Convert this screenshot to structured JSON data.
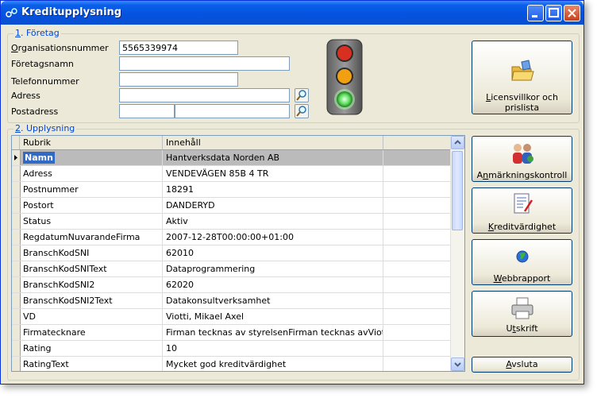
{
  "window": {
    "title": "Kreditupplysning",
    "accent": "#0a5fe8"
  },
  "foretag": {
    "legend_num": "1",
    "legend_text": ". Företag",
    "org_label_u": "O",
    "org_label_rest": "rganisationsnummer",
    "org_value": "5565339974",
    "namn_label": "Företagsnamn",
    "namn_value": "",
    "tel_label": "Telefonnummer",
    "tel_value": "",
    "adress_label": "Adress",
    "adress_value": "",
    "postadress_label": "Postadress",
    "postnr_value": "",
    "postort_value": ""
  },
  "traffic_light": {
    "active": "green",
    "colors": {
      "red": "#d83020",
      "yellow": "#f0a010",
      "green": "#60e060"
    }
  },
  "license_button": {
    "label_u": "L",
    "label_rest": "icensvillkor och",
    "label_line2": "prislista"
  },
  "upplysning": {
    "legend_num": "2",
    "legend_text": ". Upplysning",
    "columns": [
      "Rubrik",
      "Innehåll"
    ],
    "rows": [
      {
        "rubrik": "Namn",
        "innehall": "Hantverksdata Norden AB"
      },
      {
        "rubrik": "Adress",
        "innehall": "VENDEVÄGEN 85B 4 TR"
      },
      {
        "rubrik": "Postnummer",
        "innehall": "18291"
      },
      {
        "rubrik": "Postort",
        "innehall": "DANDERYD"
      },
      {
        "rubrik": "Status",
        "innehall": "Aktiv"
      },
      {
        "rubrik": "RegdatumNuvarandeFirma",
        "innehall": "2007-12-28T00:00:00+01:00"
      },
      {
        "rubrik": "BranschKodSNI",
        "innehall": "62010"
      },
      {
        "rubrik": "BranschKodSNIText",
        "innehall": "Dataprogrammering"
      },
      {
        "rubrik": "BranschKodSNI2",
        "innehall": "62020"
      },
      {
        "rubrik": "BranschKodSNI2Text",
        "innehall": "Datakonsultverksamhet"
      },
      {
        "rubrik": "VD",
        "innehall": "Viotti, Mikael Axel"
      },
      {
        "rubrik": "Firmatecknare",
        "innehall": "Firman tecknas av styrelsenFirman tecknas avViotti, Mika"
      },
      {
        "rubrik": "Rating",
        "innehall": "10"
      },
      {
        "rubrik": "RatingText",
        "innehall": "Mycket god kreditvärdighet"
      }
    ]
  },
  "side_buttons": {
    "anmarkning": {
      "pre": "A",
      "u": "n",
      "post": "märkningskontroll"
    },
    "kredit": {
      "pre": "",
      "u": "K",
      "post": "reditvärdighet"
    },
    "webb": {
      "pre": "",
      "u": "W",
      "post": "ebbrapport"
    },
    "utskrift": {
      "pre": "U",
      "u": "t",
      "post": "skrift"
    },
    "avsluta": {
      "pre": "",
      "u": "A",
      "post": "vsluta"
    }
  }
}
